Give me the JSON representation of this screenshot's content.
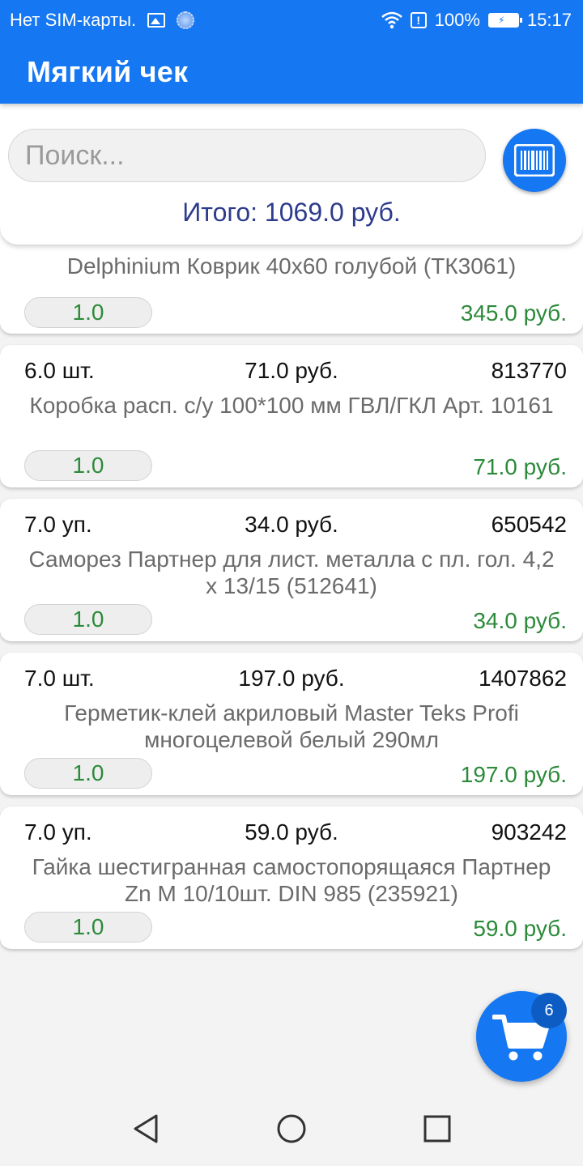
{
  "status_bar": {
    "carrier": "Нет SIM-карты.",
    "battery": "100%",
    "time": "15:17",
    "icons": [
      "image-icon",
      "sync-dot-icon",
      "wifi-icon",
      "alert-icon",
      "battery-charging-icon"
    ]
  },
  "app_bar": {
    "title": "Мягкий чек"
  },
  "search": {
    "placeholder": "Поиск...",
    "value": ""
  },
  "total": "Итого: 1069.0 руб.",
  "items": [
    {
      "qty": "",
      "price": "",
      "code": "",
      "name": "Delphinium Коврик 40х60 голубой (ТК3061)",
      "count": "1.0",
      "sum": "345.0 руб."
    },
    {
      "qty": "6.0 шт.",
      "price": "71.0 руб.",
      "code": "813770",
      "name": "Коробка расп. с/у 100*100 мм ГВЛ/ГКЛ Арт. 10161",
      "count": "1.0",
      "sum": "71.0 руб."
    },
    {
      "qty": "7.0 уп.",
      "price": "34.0 руб.",
      "code": "650542",
      "name": "Саморез Партнер для лист. металла с пл. гол. 4,2 х 13/15 (512641)",
      "count": "1.0",
      "sum": "34.0 руб."
    },
    {
      "qty": "7.0 шт.",
      "price": "197.0 руб.",
      "code": "1407862",
      "name": "Герметик-клей акриловый Master Teks Profi многоцелевой белый 290мл",
      "count": "1.0",
      "sum": "197.0 руб."
    },
    {
      "qty": "7.0 уп.",
      "price": "59.0 руб.",
      "code": "903242",
      "name": "Гайка шестигранная самостопорящаяся Партнер Zn M 10/10шт. DIN 985 (235921)",
      "count": "1.0",
      "sum": "59.0 руб."
    }
  ],
  "cart": {
    "badge_count": "6",
    "icon": "cart-icon"
  },
  "colors": {
    "primary": "#1677f2",
    "total_text": "#2d3b8c",
    "sum_text": "#2c8a3a"
  },
  "nav": [
    "back-icon",
    "home-icon",
    "recents-icon"
  ]
}
